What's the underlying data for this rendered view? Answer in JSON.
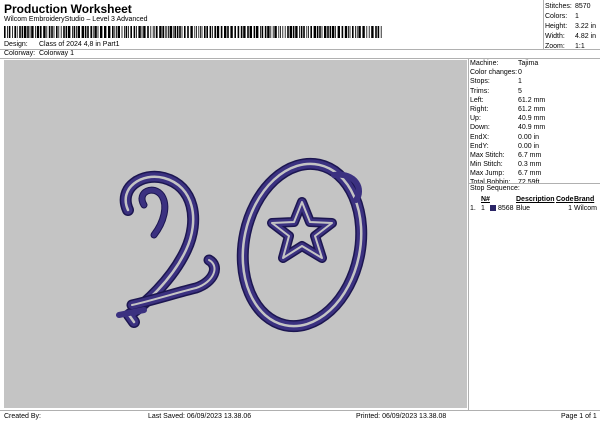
{
  "header": {
    "title": "Production Worksheet",
    "subtitle": "Wilcom EmbroideryStudio – Level 3 Advanced",
    "design_label": "Design:",
    "design_value": "Class of 2024 4,8 in Part1",
    "colorway_label": "Colorway:",
    "colorway_value": "Colorway 1"
  },
  "stats": [
    {
      "label": "Stitches:",
      "value": "8570"
    },
    {
      "label": "Colors:",
      "value": "1"
    },
    {
      "label": "Height:",
      "value": "3.22 in"
    },
    {
      "label": "Width:",
      "value": "4.82 in"
    },
    {
      "label": "Zoom:",
      "value": "1:1"
    }
  ],
  "machine_info": [
    {
      "label": "Machine:",
      "value": "Tajima"
    },
    {
      "label": "Color changes:",
      "value": "0"
    },
    {
      "label": "Stops:",
      "value": "1"
    },
    {
      "label": "Trims:",
      "value": "5"
    },
    {
      "label": "Left:",
      "value": "61.2 mm"
    },
    {
      "label": "Right:",
      "value": "61.2 mm"
    },
    {
      "label": "Up:",
      "value": "40.9 mm"
    },
    {
      "label": "Down:",
      "value": "40.9 mm"
    },
    {
      "label": "EndX:",
      "value": "0.00 in"
    },
    {
      "label": "EndY:",
      "value": "0.00 in"
    },
    {
      "label": "Max Stitch:",
      "value": "6.7 mm"
    },
    {
      "label": "Min Stitch:",
      "value": "0.3 mm"
    },
    {
      "label": "Max Jump:",
      "value": "6.7 mm"
    },
    {
      "label": "Total Bobbin:",
      "value": "72.59ft"
    }
  ],
  "stop_sequence": {
    "title": "Stop Sequence:",
    "headers": {
      "num": "N#",
      "description": "Description",
      "code": "Code",
      "brand": "Brand"
    },
    "rows": [
      {
        "index": "1.",
        "num": "1",
        "thread": "8568",
        "description": "Blue",
        "code": "1",
        "brand": "Wilcom",
        "color": "#2a2466"
      }
    ]
  },
  "design_preview": {
    "background_color": "#c4c4c4",
    "thread_color": "#3b3180",
    "outline_color": "#1c1650"
  },
  "footer": {
    "created_by": "Created By:",
    "last_saved": "Last Saved: 06/09/2023 13.38.06",
    "printed": "Printed: 06/09/2023 13.38.08",
    "page": "Page 1 of 1"
  }
}
